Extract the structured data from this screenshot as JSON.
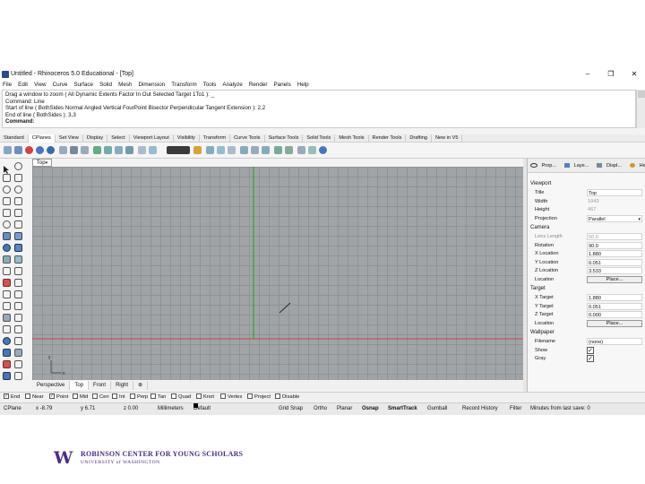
{
  "window": {
    "title": "Untitled - Rhinoceros 5.0 Educational - [Top]",
    "min_glyph": "–",
    "max_glyph": "❐",
    "close_glyph": "✕"
  },
  "menu": [
    "File",
    "Edit",
    "View",
    "Curve",
    "Surface",
    "Solid",
    "Mesh",
    "Dimension",
    "Transform",
    "Tools",
    "Analyze",
    "Render",
    "Panels",
    "Help"
  ],
  "command": {
    "history": [
      "Drag a window to zoom ( All  Dynamic  Extents  Factor  In  Out  Selected  Target  1To1 ): _",
      "Command: Line",
      "Start of line ( BothSides  Normal  Angled  Vertical  FourPoint  Bisector  Perpendicular  Tangent  Extension ): 2,2",
      "End of line ( BothSides ): 3,3"
    ],
    "prompt": "Command:"
  },
  "toolbar_tabs": [
    "Standard",
    "CPlanes",
    "Set View",
    "Display",
    "Select",
    "Viewport Layout",
    "Visibility",
    "Transform",
    "Curve Tools",
    "Surface Tools",
    "Solid Tools",
    "Mesh Tools",
    "Render Tools",
    "Drafting",
    "New in V5"
  ],
  "active_toolbar_tab": "CPlanes",
  "viewport": {
    "title": "Top",
    "menu_glyph": "▾",
    "axis_y": "y",
    "axis_x": "x",
    "tabs": [
      "Perspective",
      "Top",
      "Front",
      "Right",
      "⊕"
    ],
    "active_tab": "Top",
    "bg_color": "#a1a4a7",
    "x_axis_color": "#c0474a",
    "y_axis_color": "#3ca03c"
  },
  "panel": {
    "tabs": [
      "Prop...",
      "Laye...",
      "Displ...",
      "Help"
    ],
    "viewport_section": "Viewport",
    "viewport_rows": [
      {
        "k": "Title",
        "v": "Top"
      },
      {
        "k": "Width",
        "v": "1043"
      },
      {
        "k": "Height",
        "v": "467"
      },
      {
        "k": "Projection",
        "v": "Parallel"
      }
    ],
    "camera_section": "Camera",
    "camera_rows": [
      {
        "k": "Lens Length",
        "v": "50.0"
      },
      {
        "k": "Rotation",
        "v": "90.0"
      },
      {
        "k": "X Location",
        "v": "1.880"
      },
      {
        "k": "Y Location",
        "v": "0.051"
      },
      {
        "k": "Z Location",
        "v": "3.533"
      },
      {
        "k": "Location",
        "v": "Place..."
      }
    ],
    "target_section": "Target",
    "target_rows": [
      {
        "k": "X Target",
        "v": "1.880"
      },
      {
        "k": "Y Target",
        "v": "0.051"
      },
      {
        "k": "Z Target",
        "v": "0.000"
      },
      {
        "k": "Location",
        "v": "Place..."
      }
    ],
    "wallpaper_section": "Wallpaper",
    "wallpaper_rows": [
      {
        "k": "Filename",
        "v": "(none)"
      },
      {
        "k": "Show",
        "v": "✓"
      },
      {
        "k": "Gray",
        "v": "✓"
      }
    ]
  },
  "osnaps": [
    {
      "label": "End",
      "checked": "✓"
    },
    {
      "label": "Near",
      "checked": ""
    },
    {
      "label": "Point",
      "checked": "✓"
    },
    {
      "label": "Mid",
      "checked": ""
    },
    {
      "label": "Cen",
      "checked": ""
    },
    {
      "label": "Int",
      "checked": ""
    },
    {
      "label": "Perp",
      "checked": ""
    },
    {
      "label": "Tan",
      "checked": ""
    },
    {
      "label": "Quad",
      "checked": ""
    },
    {
      "label": "Knot",
      "checked": ""
    },
    {
      "label": "Vertex",
      "checked": ""
    },
    {
      "label": "Project",
      "checked": ""
    },
    {
      "label": "Disable",
      "checked": ""
    }
  ],
  "status": {
    "cplane": "CPlane",
    "x": "x -8.79",
    "y": "y 6.71",
    "z": "z 0.00",
    "units": "Millimeters",
    "layer": "Default",
    "grid_snap": "Grid Snap",
    "ortho": "Ortho",
    "planar": "Planar",
    "osnap": "Osnap",
    "smarttrack": "SmartTrack",
    "gumball": "Gumball",
    "record_history": "Record History",
    "filter": "Filter",
    "last_save": "Minutes from last save: 0"
  },
  "footer": {
    "logo": "W",
    "line1": "ROBINSON CENTER FOR YOUNG SCHOLARS",
    "line2": "UNIVERSITY of WASHINGTON",
    "brand_color": "#4b2e83"
  }
}
